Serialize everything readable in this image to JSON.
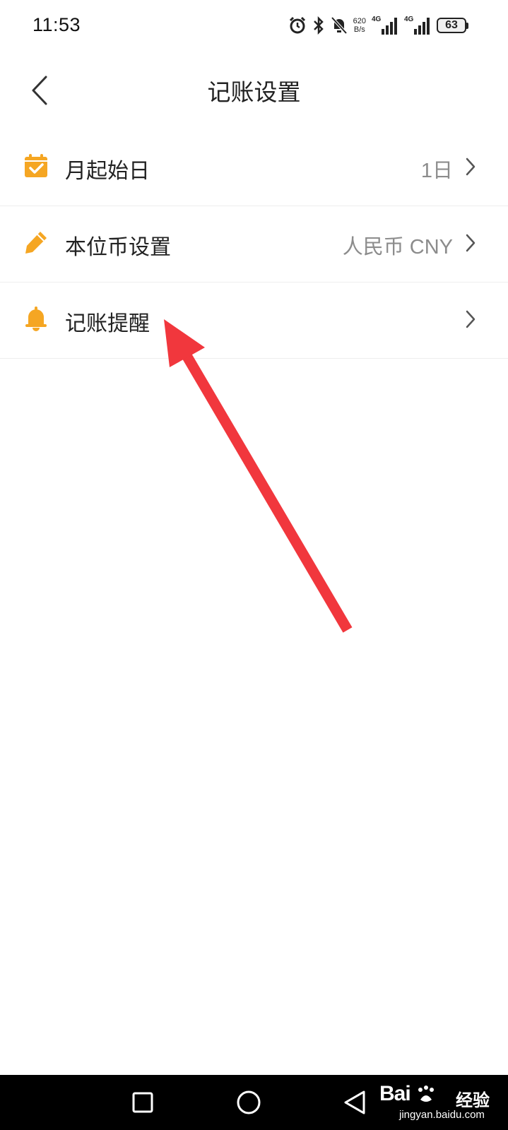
{
  "status_bar": {
    "time": "11:53",
    "net_speed_value": "620",
    "net_speed_unit": "B/s",
    "signal_1_type": "4G",
    "signal_2_type": "4G",
    "battery_level": "63"
  },
  "header": {
    "title": "记账设置",
    "back_icon": "chevron-left-icon"
  },
  "settings": [
    {
      "label": "月起始日",
      "value": "1日",
      "icon": "calendar-check-icon"
    },
    {
      "label": "本位币设置",
      "value": "人民币 CNY",
      "icon": "pencil-icon"
    },
    {
      "label": "记账提醒",
      "value": "",
      "icon": "bell-icon"
    }
  ],
  "colors": {
    "accent": "#F5A623",
    "annotation_arrow": "#F1373D",
    "text_primary": "#222222",
    "text_secondary": "#8C8C8C",
    "nav_bar": "#000000"
  },
  "nav_bar": {
    "recent_icon": "square-icon",
    "home_icon": "circle-icon",
    "back_icon": "triangle-back-icon"
  },
  "watermark": {
    "brand": "Bai",
    "brand_suffix": "经验",
    "url": "jingyan.baidu.com"
  }
}
